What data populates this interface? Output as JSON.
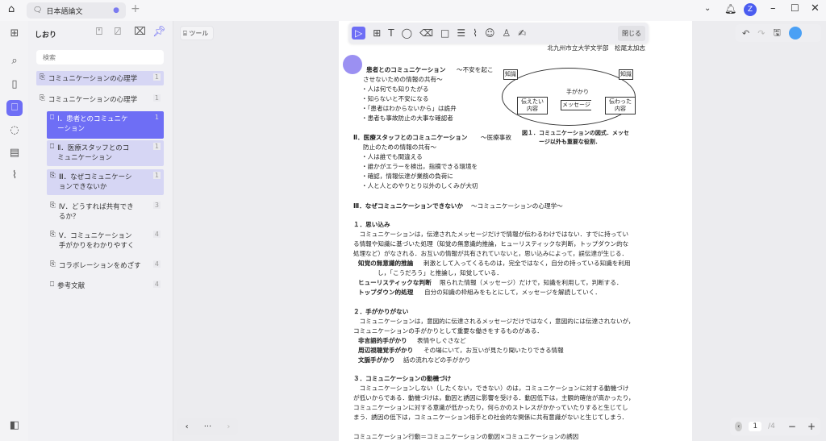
{
  "tab": {
    "title": "日本語論文"
  },
  "window": {
    "avatar": "Z"
  },
  "panel": {
    "title": "しおり",
    "search_placeholder": "検索",
    "items": [
      {
        "label": "コミュニケーションの心理学",
        "count": "1"
      },
      {
        "label": "コミュニケーションの心理学",
        "count": "1"
      },
      {
        "label": "Ⅰ．患者とのコミュニケーション",
        "count": "1"
      },
      {
        "label": "Ⅱ．医療スタッフとのコミュニケーション",
        "count": "1"
      },
      {
        "label": "Ⅲ．なぜコミュニケーションできないか",
        "count": "1"
      },
      {
        "label": "Ⅳ．どうすれば共有できるか？",
        "count": "3"
      },
      {
        "label": "Ⅴ．コミュニケーション手がかりをわかりやすく",
        "count": "4"
      },
      {
        "label": "コラボレーションをめざす",
        "count": "4"
      },
      {
        "label": "参考文献",
        "count": "4"
      }
    ]
  },
  "tools_label": "ツール",
  "toolbar": {
    "close": "閉じる"
  },
  "pager": {
    "current": "1",
    "total": "/4"
  },
  "doc": {
    "author": "北九州市立大学文学部　松尾太加志",
    "s1_title": "患者とのコミュニケーション",
    "s1_sub": "〜不安を起こ",
    "s1_sub2": "させないための情報の共有〜",
    "s1_items": [
      "・人は何でも知りたがる",
      "・知らないと不安になる",
      "・「患者はわからないから」は詭弁",
      "・患者も事故防止の大事な確認者"
    ],
    "s2_title": "Ⅱ．医療スタッフとのコミュニケーション",
    "s2_sub": "〜医療事故",
    "s2_sub2": "防止のための情報の共有〜",
    "s2_items": [
      "・人は誰でも間違える",
      "・誰かがエラーを検出，指摘できる環境を",
      "・確認，情報伝達が業務の負荷に",
      "・人と人とのやりとり以外のしくみが大切"
    ],
    "fig": {
      "k1": "知識",
      "k2": "知識",
      "send": "伝えたい内容",
      "recv": "伝わった内容",
      "msg": "メッセージ",
      "cue": "手がかり",
      "caption1": "図１．コミュニケーションの図式．メッセ",
      "caption2": "ージ以外も重要な役割．"
    },
    "s3_title": "Ⅲ．なぜコミュニケーションできないか",
    "s3_sub": "〜コミュニケーションの心理学〜",
    "h1": "１．思い込み",
    "p1": [
      "　コミュニケーションは，伝達されたメッセージだけで情報が伝わるわけではない．すでに持ってい",
      "る情報や知識に基づいた処理（知覚の無意識的推論，ヒューリスティックな判断，トップダウン的な",
      "処理など）がなされる．お互いの情報が共有されていないと，思い込みによって，誤伝達が生じる．"
    ],
    "d1_t": "知覚の無意識的推論",
    "d1": "刺激として入ってくるものは，完全ではなく，自分の持っている知識を利用",
    "d1b": "し，「こうだろう」と推論し，知覚している．",
    "d2_t": "ヒューリスティックな判断",
    "d2": "限られた情報（メッセージ）だけで，知識を利用して，判断する．",
    "d3_t": "トップダウン的処理",
    "d3": "自分の知識の枠組みをもとにして，メッセージを解読していく．",
    "h2": "２．手がかりがない",
    "p2": [
      "　コミュニケーションは，意図的に伝達されるメッセージだけではなく，意図的には伝達されないが，",
      "コミュニケーションの手がかりとして重要な働きをするものがある．"
    ],
    "e1_t": "非言語的手がかり",
    "e1": "表情やしぐさなど",
    "e2_t": "周辺視聴覚手がかり",
    "e2": "その場にいて，お互いが見たり聞いたりできる情報",
    "e3_t": "文脈手がかり",
    "e3": "話の流れなどの手がかり",
    "h3": "３．コミュニケーションの動機づけ",
    "p3": [
      "　コミュニケーションしない（したくない，できない）のは，コミュニケーションに対する動機づけ",
      "が低いからである．動機づけは，動因と誘因に影響を受ける．動因低下は，主観的確信が高かったり，",
      "コミュニケーションに対する意識が低かったり，何らかのストレスがかかっていたりすると生じてし",
      "まう．誘因の低下は，コミュニケーション相手との社会的な関係に共有意識がないと生じてしまう．"
    ],
    "last": "コミュニケーション行動＝コミュニケーションの動因×コミュニケーションの誘因"
  },
  "colors": {
    "accent": "#6e6ef5",
    "selected": "#d6d6f4"
  }
}
